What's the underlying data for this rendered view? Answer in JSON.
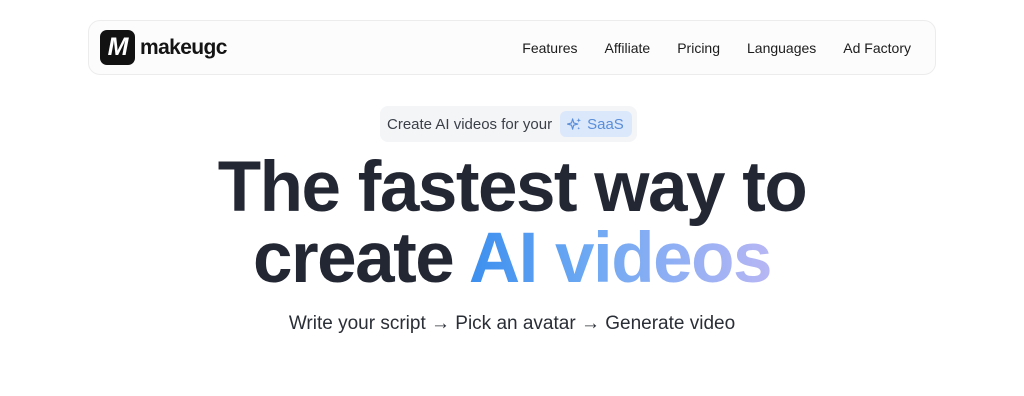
{
  "brand": {
    "logo_letter": "M",
    "name": "makeugc"
  },
  "nav": {
    "links": [
      "Features",
      "Affiliate",
      "Pricing",
      "Languages",
      "Ad Factory"
    ]
  },
  "hero": {
    "pill_text": "Create AI videos for your",
    "pill_tag_icon": "sparkles-icon",
    "pill_tag": "SaaS",
    "headline_line1": "The fastest way to",
    "headline_line2_plain": "create ",
    "headline_line2_gradient": "AI videos",
    "subtitle": "Write your script → Pick an avatar → Generate video"
  },
  "colors": {
    "headline": "#232733",
    "gradient_start": "#3c8fef",
    "gradient_end": "#b7b6f4",
    "tag_bg": "#dbe8fb",
    "tag_text": "#5a8ed9"
  }
}
